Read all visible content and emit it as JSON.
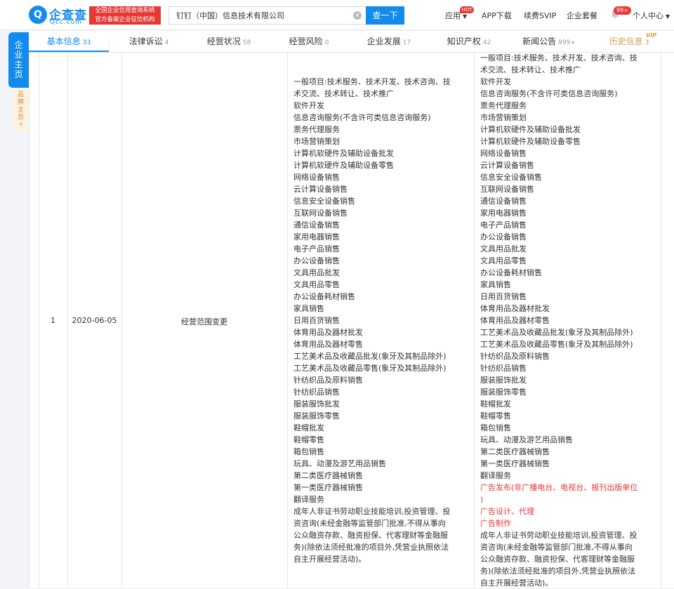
{
  "header": {
    "logo_mark": "Q",
    "logo_name": "企查查",
    "logo_domain": "Qcc.com",
    "slogan_line1": "全国企业信用查询系统",
    "slogan_line2": "官方备案企业征信机构",
    "search_value": "钉钉（中国）信息技术有限公司",
    "search_button": "查一下",
    "clear_glyph": "×",
    "nav": {
      "apps": "应用",
      "hot": "HOT",
      "app_download": "APP下载",
      "svip": "续费SVIP",
      "enterprise": "企业套餐",
      "message_count": "99+",
      "personal": "个人中心"
    }
  },
  "side": {
    "main": [
      "企",
      "业",
      "主",
      "页"
    ],
    "brand": [
      "品",
      "牌",
      "主",
      "页"
    ],
    "brand_count": "4"
  },
  "tabs": [
    {
      "label": "基本信息",
      "count": "33"
    },
    {
      "label": "法律诉讼",
      "count": "4"
    },
    {
      "label": "经营状况",
      "count": "58"
    },
    {
      "label": "经营风险",
      "count": "0"
    },
    {
      "label": "企业发展",
      "count": "17"
    },
    {
      "label": "知识产权",
      "count": "42"
    },
    {
      "label": "新闻公告",
      "count": "999+"
    },
    {
      "label": "历史信息",
      "count": "3"
    }
  ],
  "vip": "VIP",
  "record": {
    "index": "1",
    "date": "2020-06-05",
    "item": "经营范围变更",
    "before": [
      "一般项目:技术服务、技术开发、技术咨询、技",
      "术交流、技术转让、技术推广",
      "软件开发",
      "信息咨询服务(不含许可类信息咨询服务)",
      "票务代理服务",
      "市场营销策划",
      "计算机软硬件及辅助设备批发",
      "计算机软硬件及辅助设备零售",
      "网络设备销售",
      "云计算设备销售",
      "信息安全设备销售",
      "互联网设备销售",
      "通信设备销售",
      "家用电器销售",
      "电子产品销售",
      "办公设备销售",
      "文具用品批发",
      "文具用品零售",
      "办公设备耗材销售",
      "家具销售",
      "日用百货销售",
      "体育用品及器材批发",
      "体育用品及器材零售",
      "工艺美术品及收藏品批发(象牙及其制品除外)",
      "工艺美术品及收藏品零售(象牙及其制品除外)",
      "针纺织品及原料销售",
      "针纺织品销售",
      "服装服饰批发",
      "服装服饰零售",
      "鞋帽批发",
      "鞋帽零售",
      "箱包销售",
      "玩具、动漫及游艺用品销售",
      "第二类医疗器械销售",
      "第一类医疗器械销售",
      "翻译服务",
      "成年人非证书劳动职业技能培训,投资管理、投",
      "资咨询(未经金融等监管部门批准,不得从事向",
      "公众融资存款、融资担保、代客理财等金融服",
      "务)(除依法须经批准的项目外,凭营业执照依法",
      "自主开展经营活动)。"
    ],
    "after": [
      {
        "text": "一般项目:技术服务、技术开发、技术咨询、技",
        "red": false
      },
      {
        "text": "术交流、技术转让、技术推广",
        "red": false
      },
      {
        "text": "软件开发",
        "red": false
      },
      {
        "text": "信息咨询服务(不含许可类信息咨询服务)",
        "red": false
      },
      {
        "text": "票务代理服务",
        "red": false
      },
      {
        "text": "市场营销策划",
        "red": false
      },
      {
        "text": "计算机软硬件及辅助设备批发",
        "red": false
      },
      {
        "text": "计算机软硬件及辅助设备零售",
        "red": false
      },
      {
        "text": "网络设备销售",
        "red": false
      },
      {
        "text": "云计算设备销售",
        "red": false
      },
      {
        "text": "信息安全设备销售",
        "red": false
      },
      {
        "text": "互联网设备销售",
        "red": false
      },
      {
        "text": "通信设备销售",
        "red": false
      },
      {
        "text": "家用电器销售",
        "red": false
      },
      {
        "text": "电子产品销售",
        "red": false
      },
      {
        "text": "办公设备销售",
        "red": false
      },
      {
        "text": "文具用品批发",
        "red": false
      },
      {
        "text": "文具用品零售",
        "red": false
      },
      {
        "text": "办公设备耗材销售",
        "red": false
      },
      {
        "text": "家具销售",
        "red": false
      },
      {
        "text": "日用百货销售",
        "red": false
      },
      {
        "text": "体育用品及器材批发",
        "red": false
      },
      {
        "text": "体育用品及器材零售",
        "red": false
      },
      {
        "text": "工艺美术品及收藏品批发(象牙及其制品除外)",
        "red": false
      },
      {
        "text": "工艺美术品及收藏品零售(象牙及其制品除外)",
        "red": false
      },
      {
        "text": "针纺织品及原料销售",
        "red": false
      },
      {
        "text": "针纺织品销售",
        "red": false
      },
      {
        "text": "服装服饰批发",
        "red": false
      },
      {
        "text": "服装服饰零售",
        "red": false
      },
      {
        "text": "鞋帽批发",
        "red": false
      },
      {
        "text": "鞋帽零售",
        "red": false
      },
      {
        "text": "箱包销售",
        "red": false
      },
      {
        "text": "玩具、动漫及游艺用品销售",
        "red": false
      },
      {
        "text": "第二类医疗器械销售",
        "red": false
      },
      {
        "text": "第一类医疗器械销售",
        "red": false
      },
      {
        "text": "翻译服务",
        "red": false
      },
      {
        "text": "广告发布(非广播电台、电视台、报刊出版单位",
        "red": true
      },
      {
        "text": ")",
        "red": true
      },
      {
        "text": "广告设计、代理",
        "red": true
      },
      {
        "text": "广告制作",
        "red": true
      },
      {
        "text": "成年人非证书劳动职业技能培训,投资管理、投",
        "red": false
      },
      {
        "text": "资咨询(未经金融等监管部门批准,不得从事向",
        "red": false
      },
      {
        "text": "公众融资存款、融资担保、代客理财等金融服",
        "red": false
      },
      {
        "text": "务)(除依法须经批准的项目外,凭营业执照依法",
        "red": false
      },
      {
        "text": "自主开展经营活动)。",
        "red": false
      }
    ]
  }
}
